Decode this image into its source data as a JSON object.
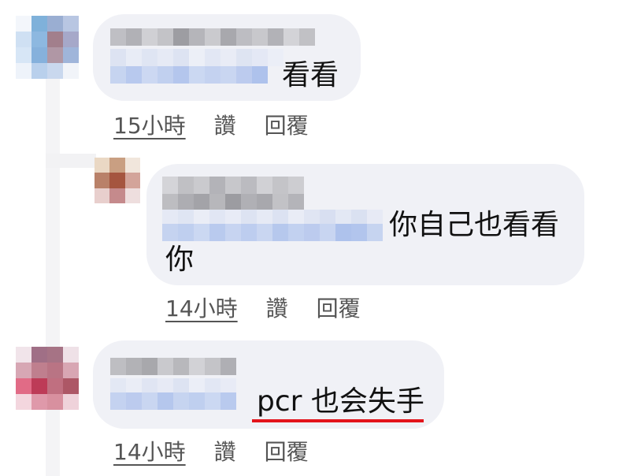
{
  "comments": [
    {
      "text_line2": "看看",
      "time": "15小時",
      "like": "讚",
      "reply": "回覆"
    },
    {
      "text_line1": "你自己也看看",
      "text_line2": "你",
      "time": "14小時",
      "like": "讚",
      "reply": "回覆"
    },
    {
      "text_line2": "pcr 也会失手",
      "time": "14小時",
      "like": "讚",
      "reply": "回覆"
    }
  ],
  "colors": {
    "bubble": "#f0f1f6",
    "highlight_underline": "#e3141b"
  }
}
